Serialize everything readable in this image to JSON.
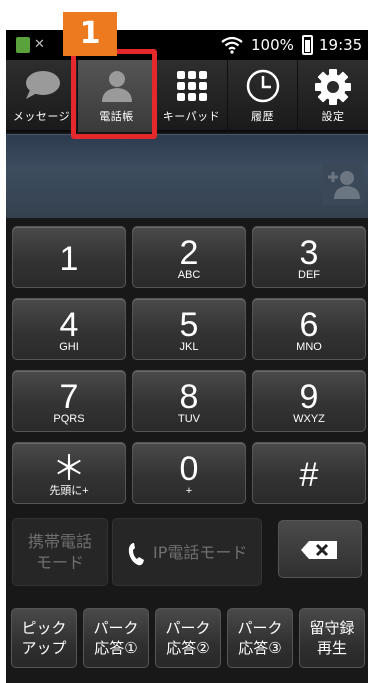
{
  "status_bar": {
    "app_icon_text": "iP",
    "battery_percent": "100%",
    "time": "19:35"
  },
  "step_marker": "1",
  "tabs": [
    {
      "label": "メッセージ",
      "icon": "speech-bubble-icon"
    },
    {
      "label": "電話帳",
      "icon": "person-icon",
      "active": true
    },
    {
      "label": "キーパッド",
      "icon": "keypad-grid-icon"
    },
    {
      "label": "履歴",
      "icon": "clock-icon"
    },
    {
      "label": "設定",
      "icon": "gear-icon"
    }
  ],
  "keys": [
    {
      "digit": "1",
      "sub": ""
    },
    {
      "digit": "2",
      "sub": "ABC"
    },
    {
      "digit": "3",
      "sub": "DEF"
    },
    {
      "digit": "4",
      "sub": "GHI"
    },
    {
      "digit": "5",
      "sub": "JKL"
    },
    {
      "digit": "6",
      "sub": "MNO"
    },
    {
      "digit": "7",
      "sub": "PQRS"
    },
    {
      "digit": "8",
      "sub": "TUV"
    },
    {
      "digit": "9",
      "sub": "WXYZ"
    },
    {
      "digit": "＊",
      "sub": "先頭に+"
    },
    {
      "digit": "0",
      "sub": "+"
    },
    {
      "digit": "#",
      "sub": ""
    }
  ],
  "mode": {
    "mobile_line1": "携帯電話",
    "mobile_line2": "モード",
    "ip_label": "IP電話モード"
  },
  "function_keys": [
    {
      "line1": "ピック",
      "line2": "アップ"
    },
    {
      "line1": "パーク",
      "line2": "応答①"
    },
    {
      "line1": "パーク",
      "line2": "応答②"
    },
    {
      "line1": "パーク",
      "line2": "応答③"
    },
    {
      "line1": "留守録",
      "line2": "再生"
    }
  ],
  "colors": {
    "highlight": "#e4282b",
    "badge": "#ee7a1f",
    "display": "#34414f"
  }
}
